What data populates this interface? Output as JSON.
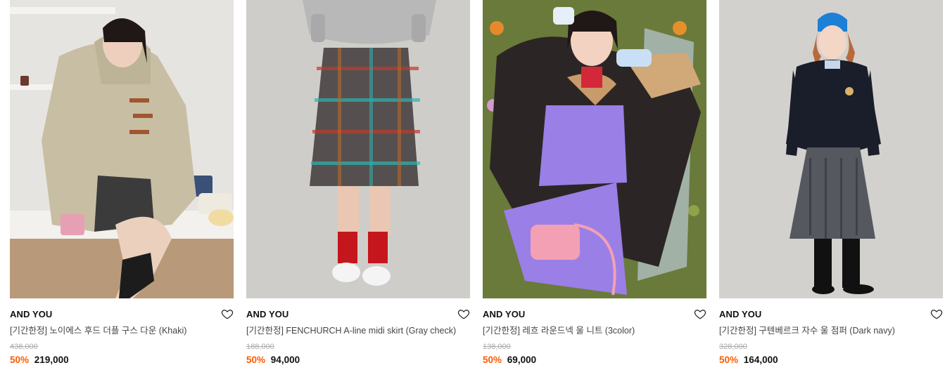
{
  "products": [
    {
      "brand": "AND YOU",
      "title": "[기간한정] 노이에스 후드 더플 구스 다운 (Khaki)",
      "original_price": "438,000",
      "discount_rate": "50%",
      "sale_price": "219,000",
      "image_icon": "product-photo-khaki-down-jacket",
      "colors": {
        "bg": "#e8e6e2",
        "main": "#c9bfa6",
        "accent": "#e9a9b8"
      }
    },
    {
      "brand": "AND YOU",
      "title": "[기간한정] FENCHURCH A-line midi skirt (Gray check)",
      "original_price": "188,000",
      "discount_rate": "50%",
      "sale_price": "94,000",
      "image_icon": "product-photo-check-skirt",
      "colors": {
        "bg": "#cfcdca",
        "main": "#5a5552",
        "accent": "#c0201e"
      }
    },
    {
      "brand": "AND YOU",
      "title": "[기간한정] 레흐 라운드넥 울 니트 (3color)",
      "original_price": "138,000",
      "discount_rate": "50%",
      "sale_price": "69,000",
      "image_icon": "product-photo-purple-knit",
      "colors": {
        "bg": "#6f7f3c",
        "main": "#9a7fe6",
        "accent": "#f2a0b2"
      }
    },
    {
      "brand": "AND YOU",
      "title": "[기간한정] 구텐베르크 자수 울 점퍼 (Dark navy)",
      "original_price": "328,000",
      "discount_rate": "50%",
      "sale_price": "164,000",
      "image_icon": "product-photo-navy-jumper",
      "colors": {
        "bg": "#d4d2ce",
        "main": "#1a1d2a",
        "accent": "#1e7fd6"
      }
    }
  ],
  "heart_icon": "heart-outline-icon"
}
